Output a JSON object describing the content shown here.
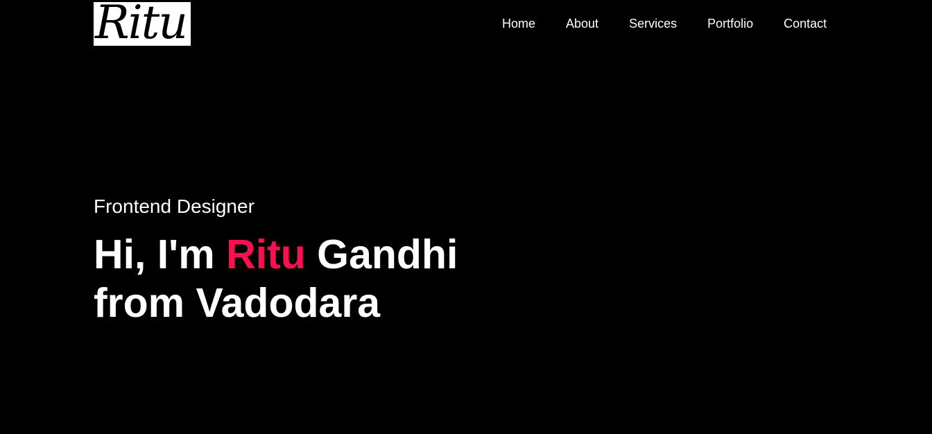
{
  "logo": {
    "text": "Ritu"
  },
  "nav": {
    "items": [
      {
        "label": "Home"
      },
      {
        "label": "About"
      },
      {
        "label": "Services"
      },
      {
        "label": "Portfolio"
      },
      {
        "label": "Contact"
      }
    ]
  },
  "hero": {
    "subtitle": "Frontend Designer",
    "title_prefix": "Hi, I'm",
    "title_highlight": "Ritu",
    "title_suffix": "Gandhi",
    "title_line2": "from Vadodara"
  },
  "colors": {
    "background": "#000000",
    "text": "#ffffff",
    "accent": "#f7114f",
    "logo_background": "#ffffff"
  }
}
